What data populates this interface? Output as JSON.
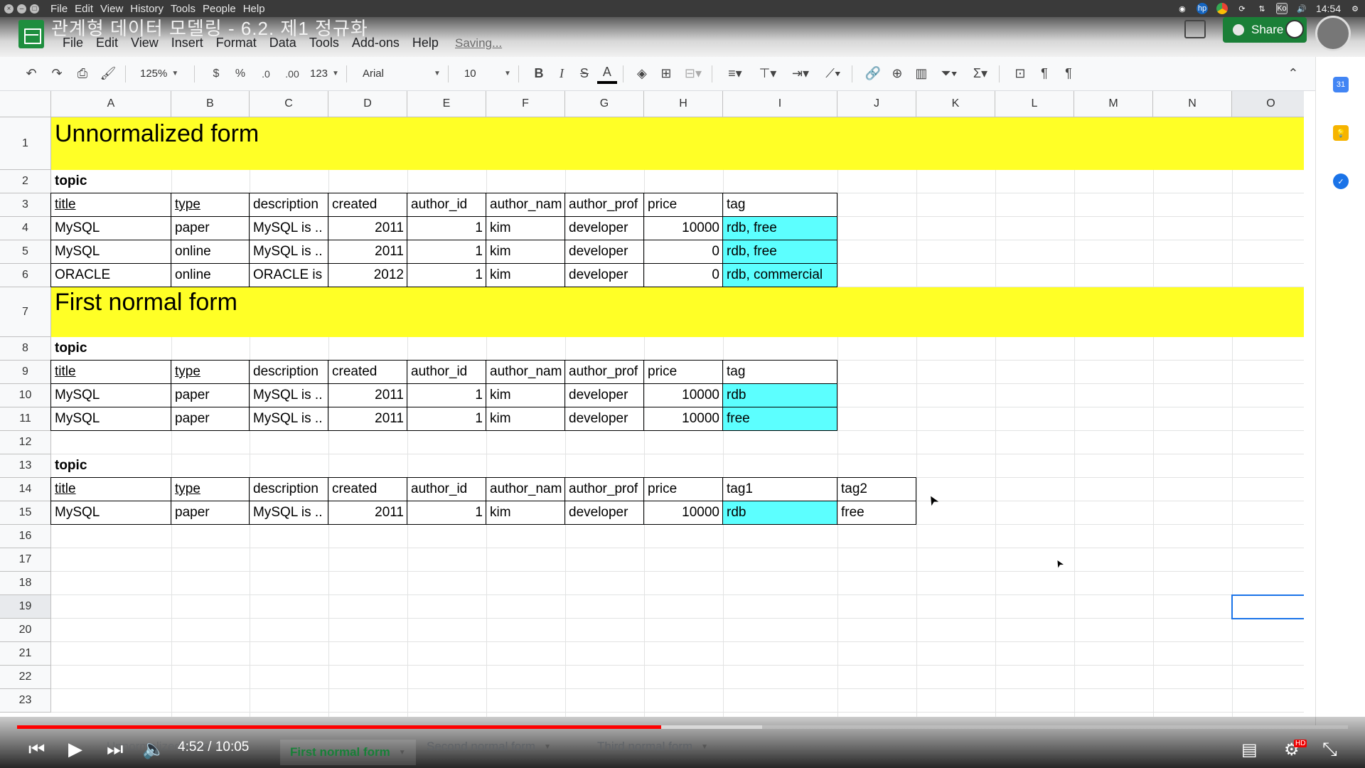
{
  "os_bar": {
    "menu": [
      "File",
      "Edit",
      "View",
      "History",
      "Tools",
      "People",
      "Help"
    ],
    "tray_lang": "Ko",
    "clock": "14:54"
  },
  "header": {
    "doc_title": "관계형 데이터 모델링 - 6.2. 제1 정규화",
    "menu": [
      "File",
      "Edit",
      "View",
      "Insert",
      "Format",
      "Data",
      "Tools",
      "Add-ons",
      "Help"
    ],
    "saving": "Saving...",
    "share": "Share"
  },
  "toolbar": {
    "zoom": "125%",
    "currency": "$",
    "percent": "%",
    "dec_less": ".0",
    "dec_more": ".00",
    "format_123": "123",
    "font": "Arial",
    "font_size": "10",
    "bold": "B",
    "italic": "I",
    "strike": "S",
    "text_color": "A"
  },
  "grid": {
    "columns": [
      "A",
      "B",
      "C",
      "D",
      "E",
      "F",
      "G",
      "H",
      "I",
      "J",
      "K",
      "L",
      "M",
      "N",
      "O"
    ],
    "rows": [
      "1",
      "2",
      "3",
      "4",
      "5",
      "6",
      "7",
      "8",
      "9",
      "10",
      "11",
      "12",
      "13",
      "14",
      "15",
      "16",
      "17",
      "18",
      "19",
      "20",
      "21",
      "22",
      "23"
    ],
    "banner1": "Unnormalized form",
    "banner2": "First normal form",
    "topic": "topic",
    "headers": [
      "title",
      "type",
      "description",
      "created",
      "author_id",
      "author_nam",
      "author_prof",
      "price",
      "tag"
    ],
    "headers3": [
      "title",
      "type",
      "description",
      "created",
      "author_id",
      "author_nam",
      "author_prof",
      "price",
      "tag1",
      "tag2"
    ],
    "table1": [
      [
        "MySQL",
        "paper",
        "MySQL is ..",
        "2011",
        "1",
        "kim",
        "developer",
        "10000",
        "rdb, free"
      ],
      [
        "MySQL",
        "online",
        "MySQL is ..",
        "2011",
        "1",
        "kim",
        "developer",
        "0",
        "rdb, free"
      ],
      [
        "ORACLE",
        "online",
        "ORACLE is",
        "2012",
        "1",
        "kim",
        "developer",
        "0",
        "rdb, commercial"
      ]
    ],
    "table2": [
      [
        "MySQL",
        "paper",
        "MySQL is ..",
        "2011",
        "1",
        "kim",
        "developer",
        "10000",
        "rdb"
      ],
      [
        "MySQL",
        "paper",
        "MySQL is ..",
        "2011",
        "1",
        "kim",
        "developer",
        "10000",
        "free"
      ]
    ],
    "table3": [
      [
        "MySQL",
        "paper",
        "MySQL is ..",
        "2011",
        "1",
        "kim",
        "developer",
        "10000",
        "rdb",
        "free"
      ]
    ],
    "highlight_color": "#5cffff",
    "banner_color": "#ffff26"
  },
  "player": {
    "time": "4:52 / 10:05",
    "progress": 0.484,
    "buffered": 0.56,
    "sheet_tabs": [
      "Unnormalized form",
      "First normal form",
      "Second normal form",
      "Third normal form"
    ],
    "active_tab": "First normal form",
    "hd_badge": "HD"
  }
}
